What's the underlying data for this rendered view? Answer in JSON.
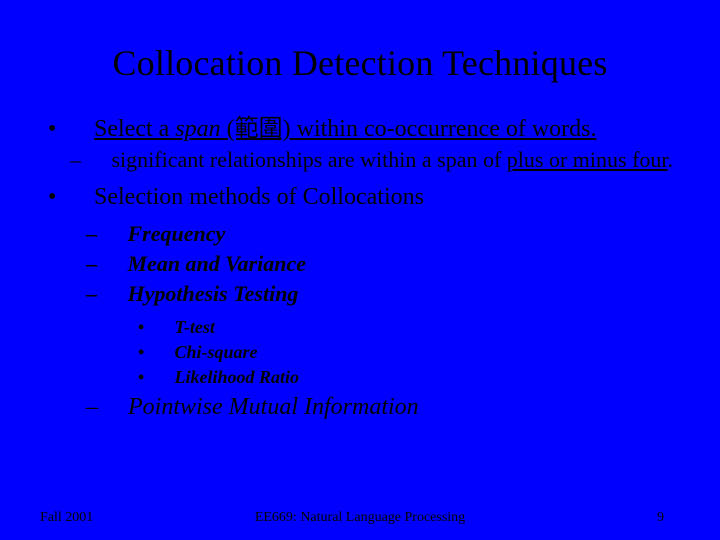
{
  "title": "Collocation Detection Techniques",
  "main1": {
    "pre": "Select a ",
    "span_word": "span",
    "paren": " (範圍) ",
    "post": "within co-occurrence of words."
  },
  "sub1": {
    "pre": "significant relationships are within a span of ",
    "uline": "plus or minus four",
    "post": "."
  },
  "main2": "Selection methods of Collocations",
  "methods": {
    "freq": "Frequency",
    "mv": "Mean and Variance",
    "ht": "Hypothesis Testing"
  },
  "tests": {
    "t": "T-test",
    "chi": "Chi-square",
    "lr": "Likelihood Ratio"
  },
  "pmi": "Pointwise Mutual Information",
  "footer": {
    "left": "Fall 2001",
    "center": "EE669: Natural Language Processing",
    "page": "9"
  }
}
